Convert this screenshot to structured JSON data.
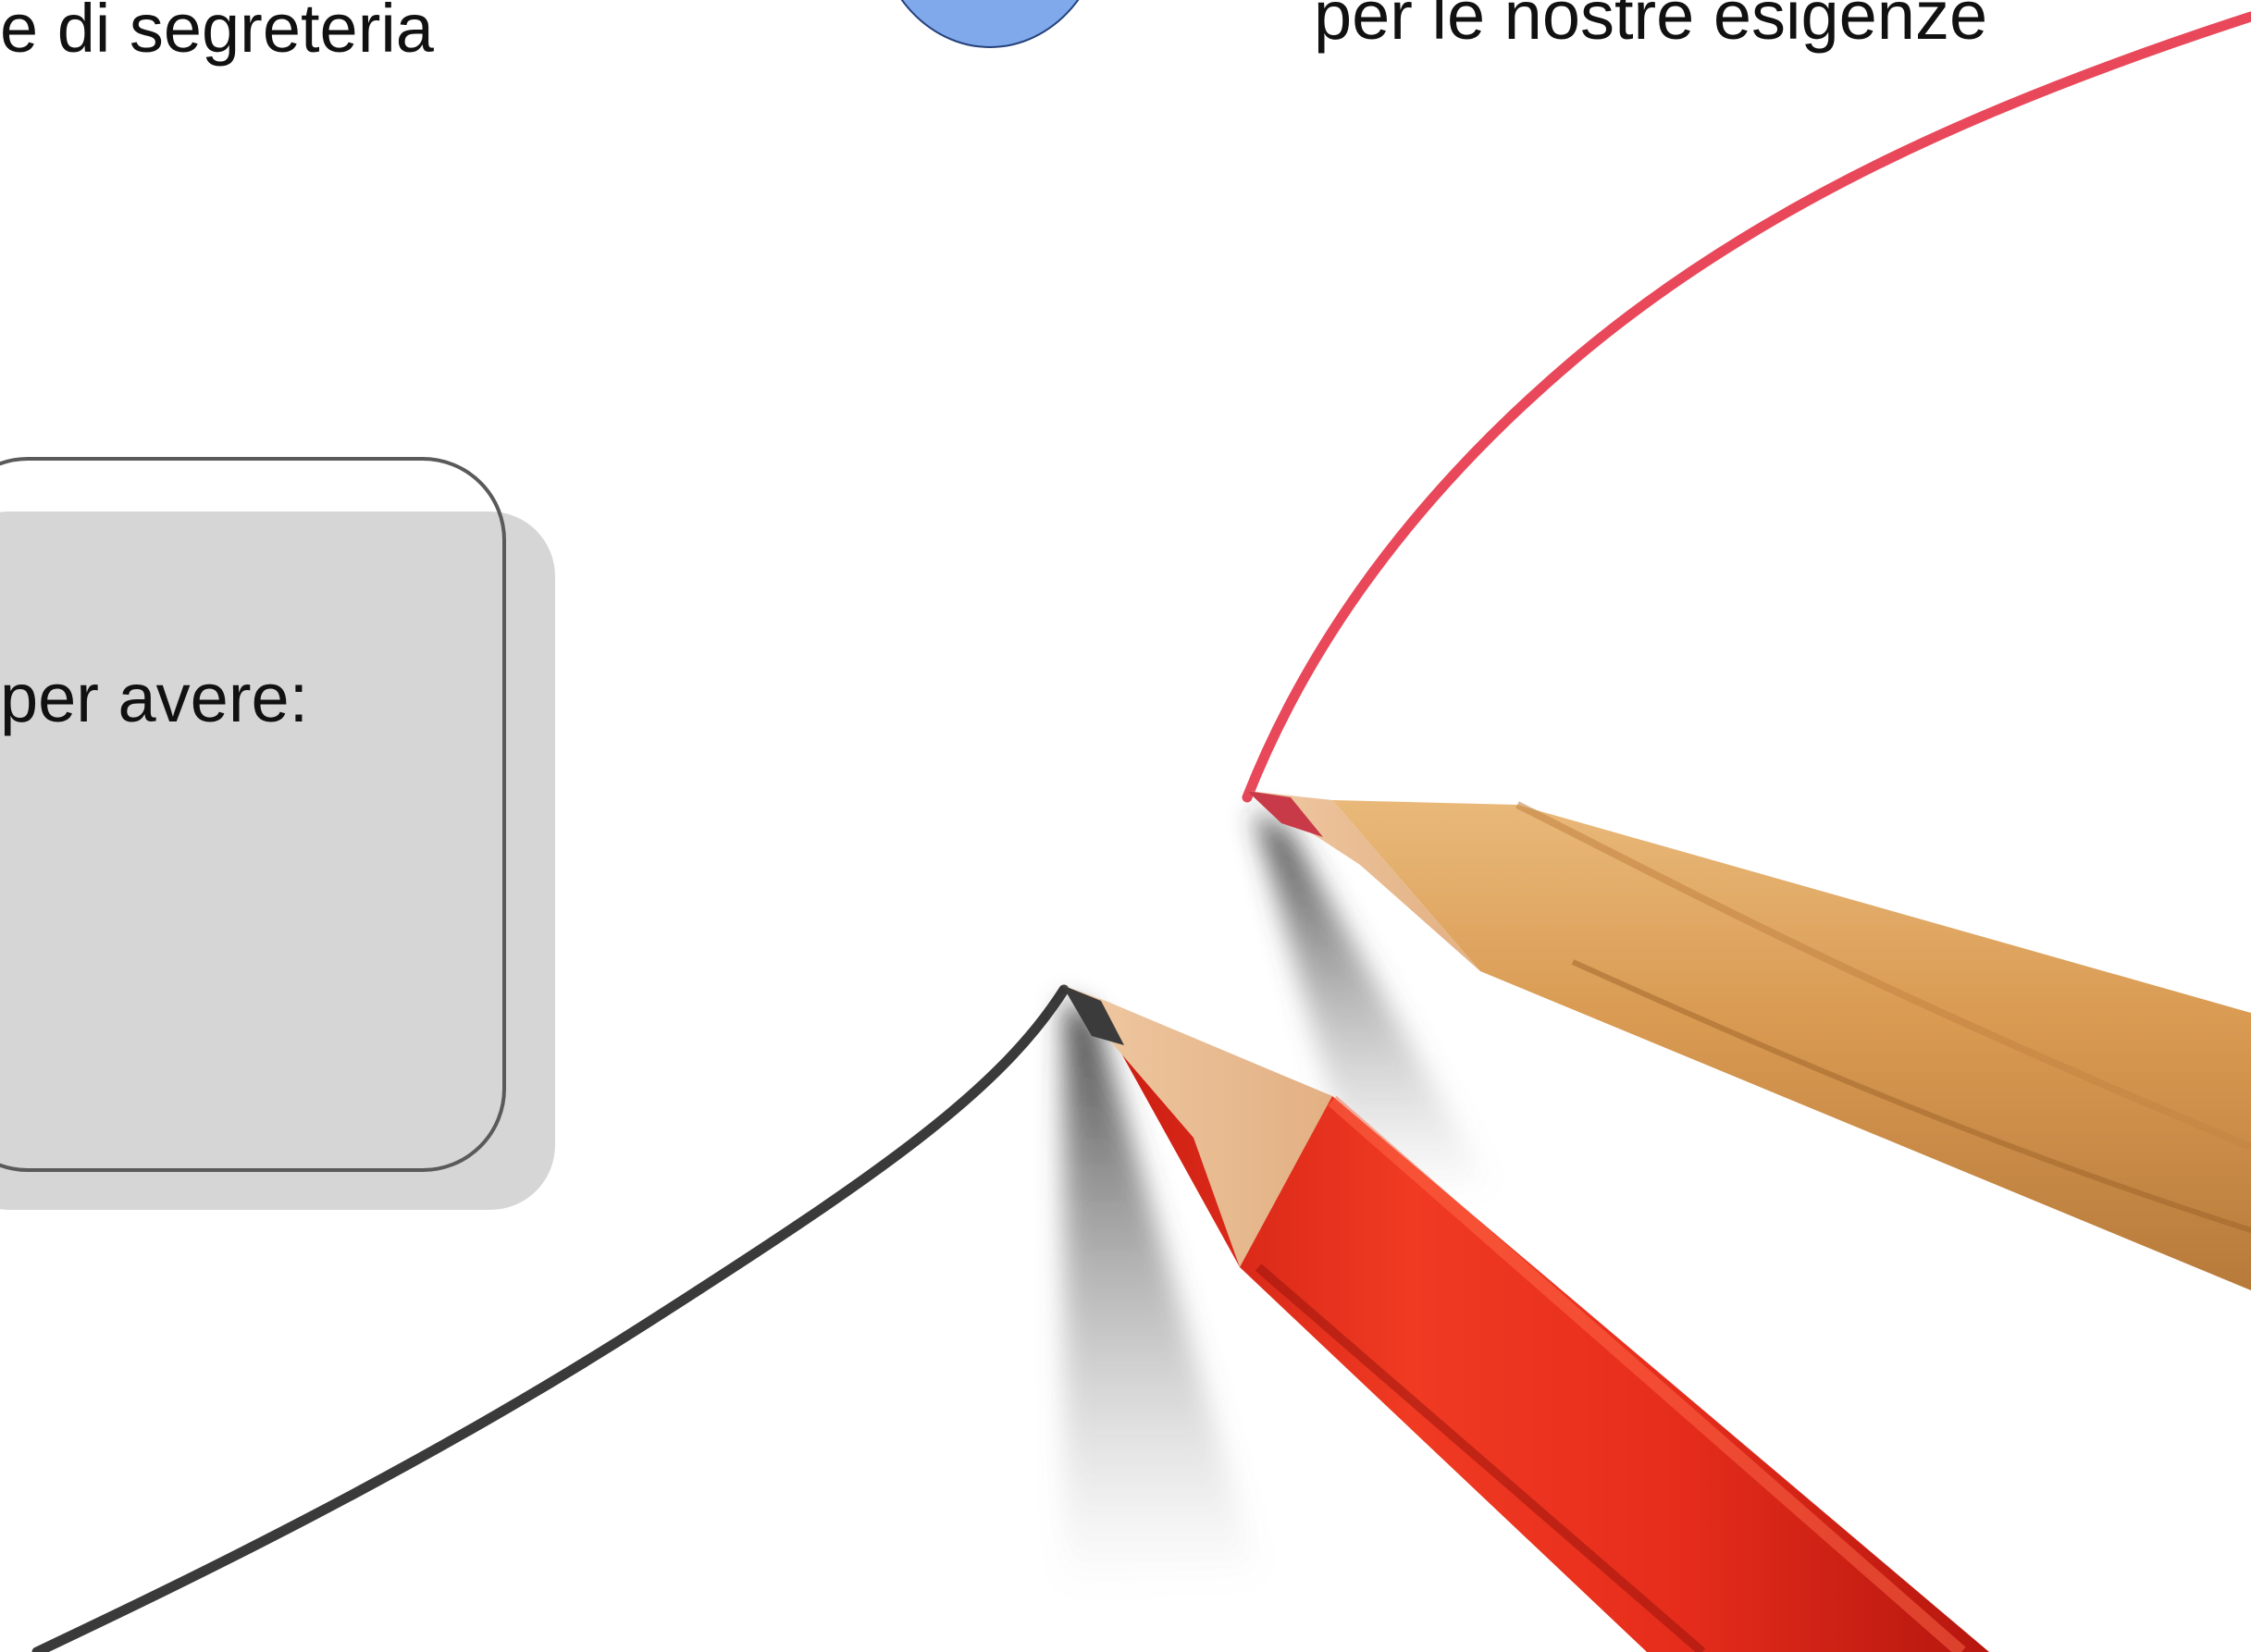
{
  "slide": {
    "caption_left": "e di segreteria",
    "caption_right": "per le nostre esigenze",
    "card_text": "per avere:"
  },
  "colors": {
    "background": "#ffffff",
    "circle_fill": "#7fa9ea",
    "circle_border": "#24407a",
    "card_fill": "#d6d6d6",
    "card_border": "#5a5a5a",
    "red_line": "#e8485a",
    "black_line": "#3a3a3a",
    "red_pencil": "#e32b1f",
    "natural_pencil": "#d9a05c"
  },
  "illustration": {
    "icons": [
      "red-pencil-icon",
      "natural-pencil-icon",
      "red-line-icon",
      "black-line-icon"
    ]
  }
}
